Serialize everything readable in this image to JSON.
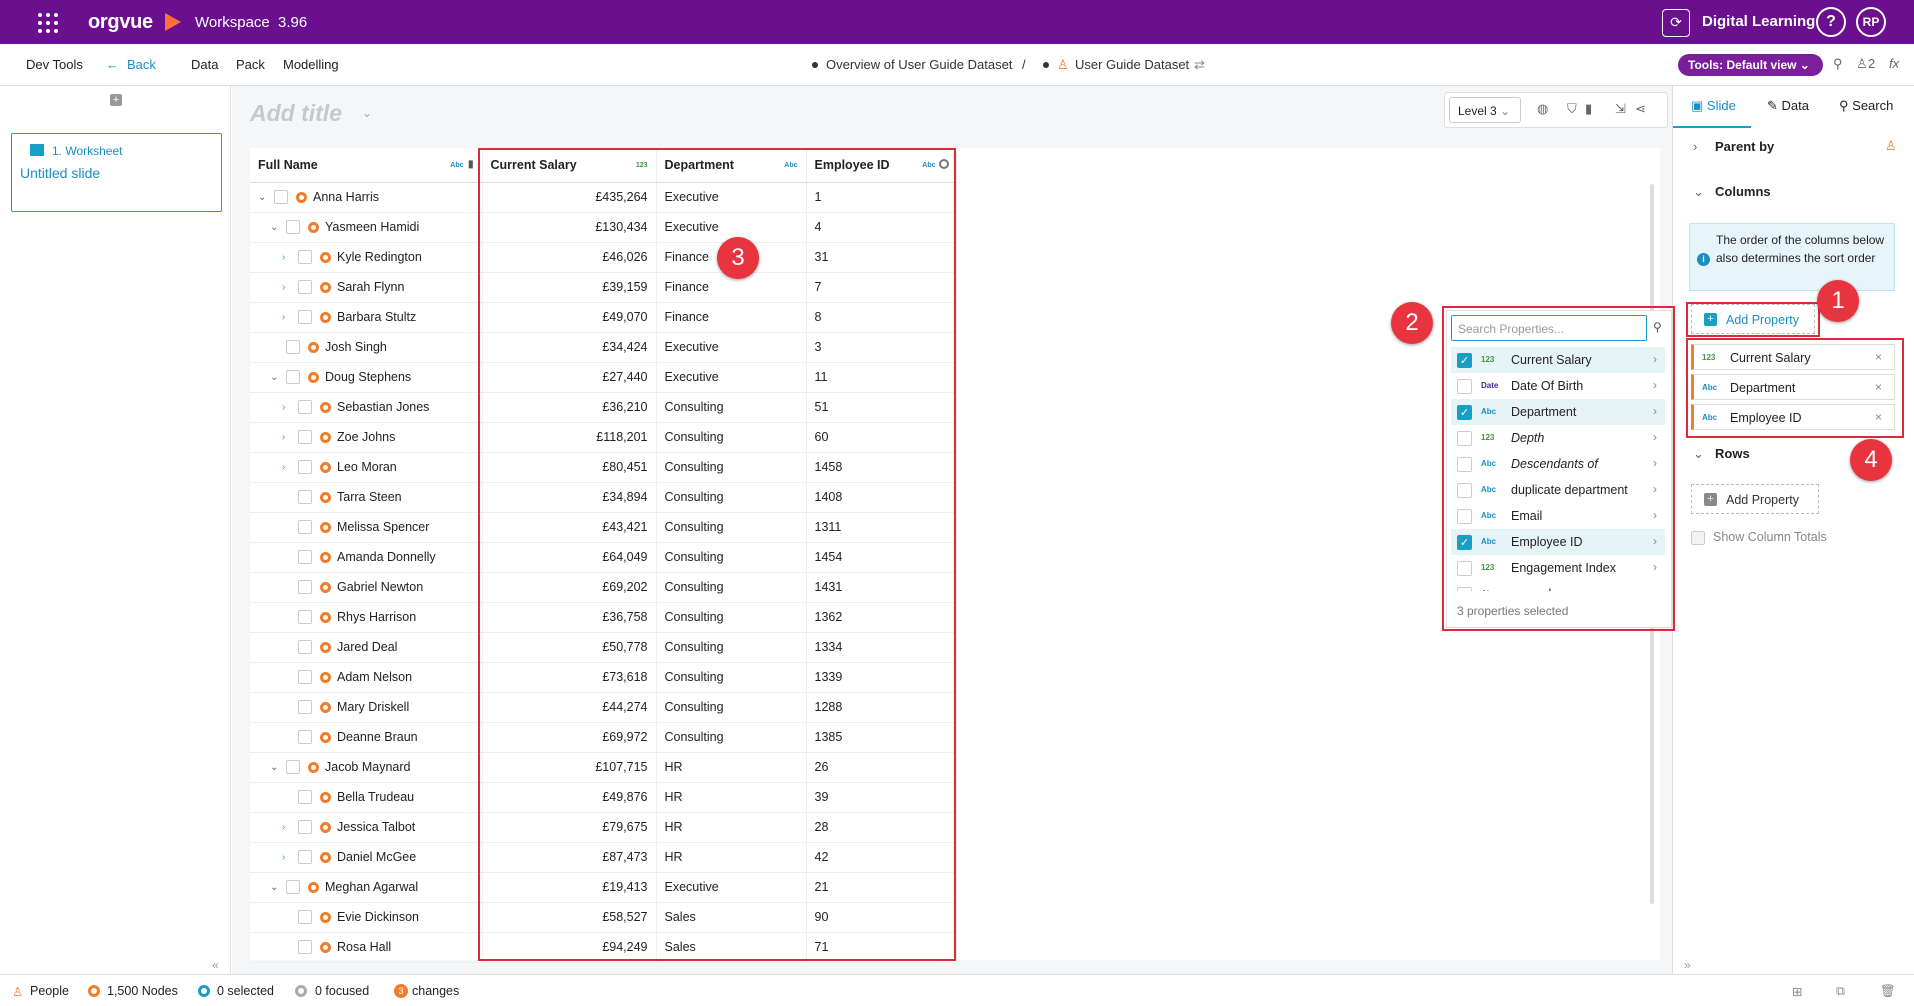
{
  "topbar": {
    "app_name": "orgvue",
    "workspace": "Workspace",
    "version": "3.96",
    "org_name": "Digital Learning",
    "help": "?",
    "avatar": "RP"
  },
  "navbar": {
    "dev_tools": "Dev Tools",
    "back": "Back",
    "data": "Data",
    "pack": "Pack",
    "modelling": "Modelling",
    "crumb_1": "Overview of User Guide Dataset",
    "separator": "/",
    "crumb_2": "User Guide Dataset",
    "tools_button": "Tools: Default view",
    "people_count": "2"
  },
  "slides": {
    "worksheet_label": "1. Worksheet",
    "slide_title": "Untitled slide"
  },
  "canvas": {
    "add_title_placeholder": "Add title",
    "level_select": "Level 3"
  },
  "table": {
    "columns": [
      "Full Name",
      "Current Salary",
      "Department",
      "Employee ID"
    ],
    "column_types": [
      "Abc",
      "123",
      "Abc",
      "Abc"
    ],
    "rows": [
      {
        "name": "Anna Harris",
        "salary": "£435,264",
        "dept": "Executive",
        "id": "1",
        "indent": 0,
        "chev": "down"
      },
      {
        "name": "Yasmeen Hamidi",
        "salary": "£130,434",
        "dept": "Executive",
        "id": "4",
        "indent": 1,
        "chev": "down"
      },
      {
        "name": "Kyle Redington",
        "salary": "£46,026",
        "dept": "Finance",
        "id": "31",
        "indent": 2,
        "chev": "right"
      },
      {
        "name": "Sarah Flynn",
        "salary": "£39,159",
        "dept": "Finance",
        "id": "7",
        "indent": 2,
        "chev": "right"
      },
      {
        "name": "Barbara Stultz",
        "salary": "£49,070",
        "dept": "Finance",
        "id": "8",
        "indent": 2,
        "chev": "right"
      },
      {
        "name": "Josh Singh",
        "salary": "£34,424",
        "dept": "Executive",
        "id": "3",
        "indent": 1,
        "chev": "none"
      },
      {
        "name": "Doug Stephens",
        "salary": "£27,440",
        "dept": "Executive",
        "id": "11",
        "indent": 1,
        "chev": "down"
      },
      {
        "name": "Sebastian Jones",
        "salary": "£36,210",
        "dept": "Consulting",
        "id": "51",
        "indent": 2,
        "chev": "right"
      },
      {
        "name": "Zoe Johns",
        "salary": "£118,201",
        "dept": "Consulting",
        "id": "60",
        "indent": 2,
        "chev": "right"
      },
      {
        "name": "Leo Moran",
        "salary": "£80,451",
        "dept": "Consulting",
        "id": "1458",
        "indent": 2,
        "chev": "right"
      },
      {
        "name": "Tarra Steen",
        "salary": "£34,894",
        "dept": "Consulting",
        "id": "1408",
        "indent": 2,
        "chev": "none"
      },
      {
        "name": "Melissa Spencer",
        "salary": "£43,421",
        "dept": "Consulting",
        "id": "1311",
        "indent": 2,
        "chev": "none"
      },
      {
        "name": "Amanda Donnelly",
        "salary": "£64,049",
        "dept": "Consulting",
        "id": "1454",
        "indent": 2,
        "chev": "none"
      },
      {
        "name": "Gabriel Newton",
        "salary": "£69,202",
        "dept": "Consulting",
        "id": "1431",
        "indent": 2,
        "chev": "none"
      },
      {
        "name": "Rhys Harrison",
        "salary": "£36,758",
        "dept": "Consulting",
        "id": "1362",
        "indent": 2,
        "chev": "none"
      },
      {
        "name": "Jared Deal",
        "salary": "£50,778",
        "dept": "Consulting",
        "id": "1334",
        "indent": 2,
        "chev": "none"
      },
      {
        "name": "Adam Nelson",
        "salary": "£73,618",
        "dept": "Consulting",
        "id": "1339",
        "indent": 2,
        "chev": "none"
      },
      {
        "name": "Mary Driskell",
        "salary": "£44,274",
        "dept": "Consulting",
        "id": "1288",
        "indent": 2,
        "chev": "none"
      },
      {
        "name": "Deanne Braun",
        "salary": "£69,972",
        "dept": "Consulting",
        "id": "1385",
        "indent": 2,
        "chev": "none"
      },
      {
        "name": "Jacob Maynard",
        "salary": "£107,715",
        "dept": "HR",
        "id": "26",
        "indent": 1,
        "chev": "down"
      },
      {
        "name": "Bella Trudeau",
        "salary": "£49,876",
        "dept": "HR",
        "id": "39",
        "indent": 2,
        "chev": "none"
      },
      {
        "name": "Jessica Talbot",
        "salary": "£79,675",
        "dept": "HR",
        "id": "28",
        "indent": 2,
        "chev": "right"
      },
      {
        "name": "Daniel McGee",
        "salary": "£87,473",
        "dept": "HR",
        "id": "42",
        "indent": 2,
        "chev": "right"
      },
      {
        "name": "Meghan Agarwal",
        "salary": "£19,413",
        "dept": "Executive",
        "id": "21",
        "indent": 1,
        "chev": "down"
      },
      {
        "name": "Evie Dickinson",
        "salary": "£58,527",
        "dept": "Sales",
        "id": "90",
        "indent": 2,
        "chev": "none"
      },
      {
        "name": "Rosa Hall",
        "salary": "£94,249",
        "dept": "Sales",
        "id": "71",
        "indent": 2,
        "chev": "none"
      }
    ]
  },
  "picker": {
    "search_placeholder": "Search Properties...",
    "items": [
      {
        "type": "123",
        "label": "Current Salary",
        "checked": true,
        "italic": false
      },
      {
        "type": "Date",
        "label": "Date Of Birth",
        "checked": false,
        "italic": false
      },
      {
        "type": "Abc",
        "label": "Department",
        "checked": true,
        "italic": false
      },
      {
        "type": "123",
        "label": "Depth",
        "checked": false,
        "italic": true
      },
      {
        "type": "Abc",
        "label": "Descendants of",
        "checked": false,
        "italic": true
      },
      {
        "type": "Abc",
        "label": "duplicate department",
        "checked": false,
        "italic": false
      },
      {
        "type": "Abc",
        "label": "Email",
        "checked": false,
        "italic": false
      },
      {
        "type": "Abc",
        "label": "Employee ID",
        "checked": true,
        "italic": false
      },
      {
        "type": "123",
        "label": "Engagement Index",
        "checked": false,
        "italic": false
      },
      {
        "type": "Abc",
        "label": "example none",
        "checked": false,
        "italic": false
      }
    ],
    "footer": "3 properties selected"
  },
  "rpanel": {
    "tabs": [
      "Slide",
      "Data",
      "Search"
    ],
    "parent_by": "Parent by",
    "columns": "Columns",
    "info": "The order of the columns below also determines the sort order",
    "add_property": "Add Property",
    "column_items": [
      {
        "type": "123",
        "label": "Current Salary"
      },
      {
        "type": "Abc",
        "label": "Department"
      },
      {
        "type": "Abc",
        "label": "Employee ID"
      }
    ],
    "rows": "Rows",
    "add_property_rows": "Add Property",
    "show_totals": "Show Column Totals"
  },
  "status": {
    "people": "People",
    "nodes": "1,500 Nodes",
    "selected": "0 selected",
    "focused": "0 focused",
    "changes_count": "3",
    "changes": "changes"
  },
  "badges": [
    "1",
    "2",
    "3",
    "4"
  ],
  "colors": {
    "header_bg": "#6a0f8e",
    "accent": "#1a9fc4",
    "node": "#ef7d2a",
    "highlight": "#e0283c"
  }
}
